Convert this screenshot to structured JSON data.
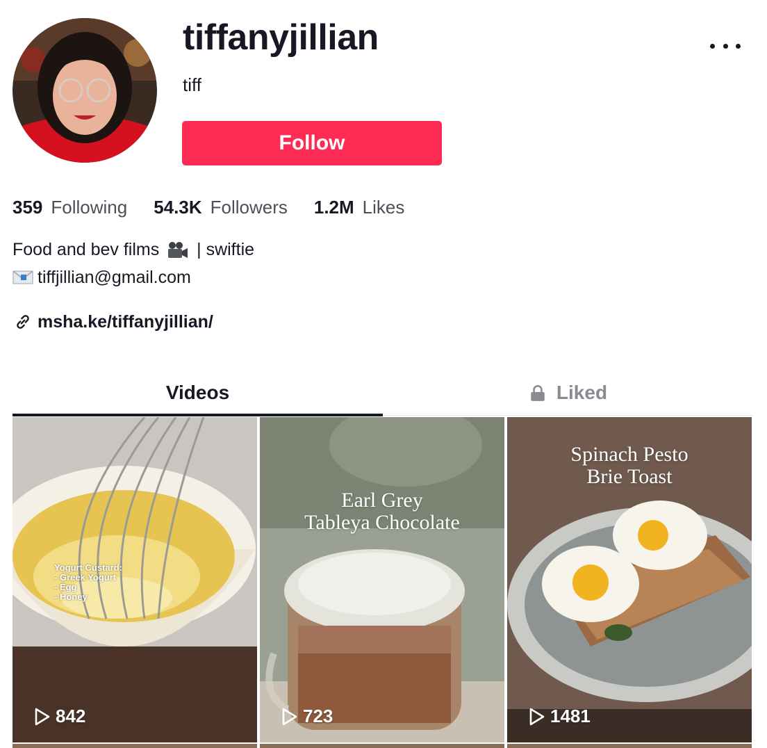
{
  "profile": {
    "username": "tiffanyjillian",
    "nickname": "tiff",
    "follow_label": "Follow",
    "more_icon": "more-horizontal-icon"
  },
  "stats": [
    {
      "value": "359",
      "label": "Following"
    },
    {
      "value": "54.3K",
      "label": "Followers"
    },
    {
      "value": "1.2M",
      "label": "Likes"
    }
  ],
  "bio": {
    "line1_before": "Food and bev films",
    "line1_after": "| swiftie",
    "line2": "tiffjillian@gmail.com"
  },
  "link": {
    "text": "msha.ke/tiffanyjillian/"
  },
  "tabs": [
    {
      "label": "Videos",
      "active": true
    },
    {
      "label": "Liked",
      "active": false,
      "icon": "lock-icon"
    }
  ],
  "videos": [
    {
      "views": "842",
      "overlay": "Yogurt Custard:\n- Greek Yogurt\n- Egg\n- Honey"
    },
    {
      "views": "723",
      "overlay": "Earl Grey\nTableya Chocolate"
    },
    {
      "views": "1481",
      "overlay": "Spinach Pesto\nBrie Toast"
    }
  ],
  "colors": {
    "accent": "#fe2c55",
    "text": "#161823",
    "muted": "#8a8b91"
  }
}
